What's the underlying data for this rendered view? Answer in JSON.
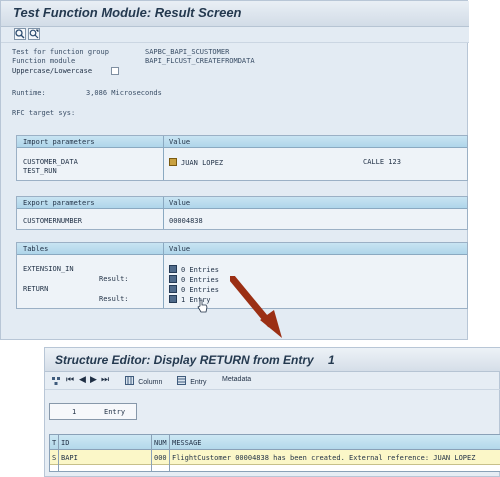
{
  "result_screen": {
    "title": "Test Function Module: Result Screen",
    "toolbar": {
      "icons": [
        "execute-icon",
        "find-icon"
      ]
    },
    "info": {
      "function_group_label": "Test for function group",
      "function_group_value": "SAPBC_BAPI_SCUSTOMER",
      "function_module_label": "Function module",
      "function_module_value": "BAPI_FLCUST_CREATEFROMDATA",
      "uppercase_label": "Uppercase/Lowercase",
      "runtime_label": "Runtime:",
      "runtime_value": "3,086 Microseconds",
      "rfc_label": "RFC target sys:"
    },
    "import_panel": {
      "header": "Import parameters",
      "value_header": "Value",
      "rows": [
        {
          "name": "CUSTOMER_DATA",
          "value": "JUAN LOPEZ",
          "value2": "CALLE 123"
        },
        {
          "name": "TEST_RUN",
          "value": ""
        }
      ]
    },
    "export_panel": {
      "header": "Export parameters",
      "value_header": "Value",
      "rows": [
        {
          "name": "CUSTOMERNUMBER",
          "value": "00004838"
        }
      ]
    },
    "tables_panel": {
      "header": "Tables",
      "value_header": "Value",
      "rows": [
        {
          "name": "EXTENSION_IN",
          "value": "0 Entries"
        },
        {
          "name": "Result:",
          "value": "0 Entries"
        },
        {
          "name": "RETURN",
          "value": "0 Entries"
        },
        {
          "name": "Result:",
          "value": "1 Entry"
        }
      ]
    }
  },
  "structure_editor": {
    "title": "Structure Editor: Display RETURN from Entry",
    "title_entry": "1",
    "toolbar": {
      "column_label": "Column",
      "entry_label": "Entry",
      "metadata_label": "Metadata"
    },
    "entry_number": "1",
    "entry_label": "Entry",
    "table": {
      "headers": [
        "T",
        "ID",
        "NUM",
        "MESSAGE"
      ],
      "row": [
        "S",
        "BAPI",
        "000",
        "FlightCustomer 00004838 has been created. External reference: JUAN LOPEZ"
      ]
    }
  }
}
